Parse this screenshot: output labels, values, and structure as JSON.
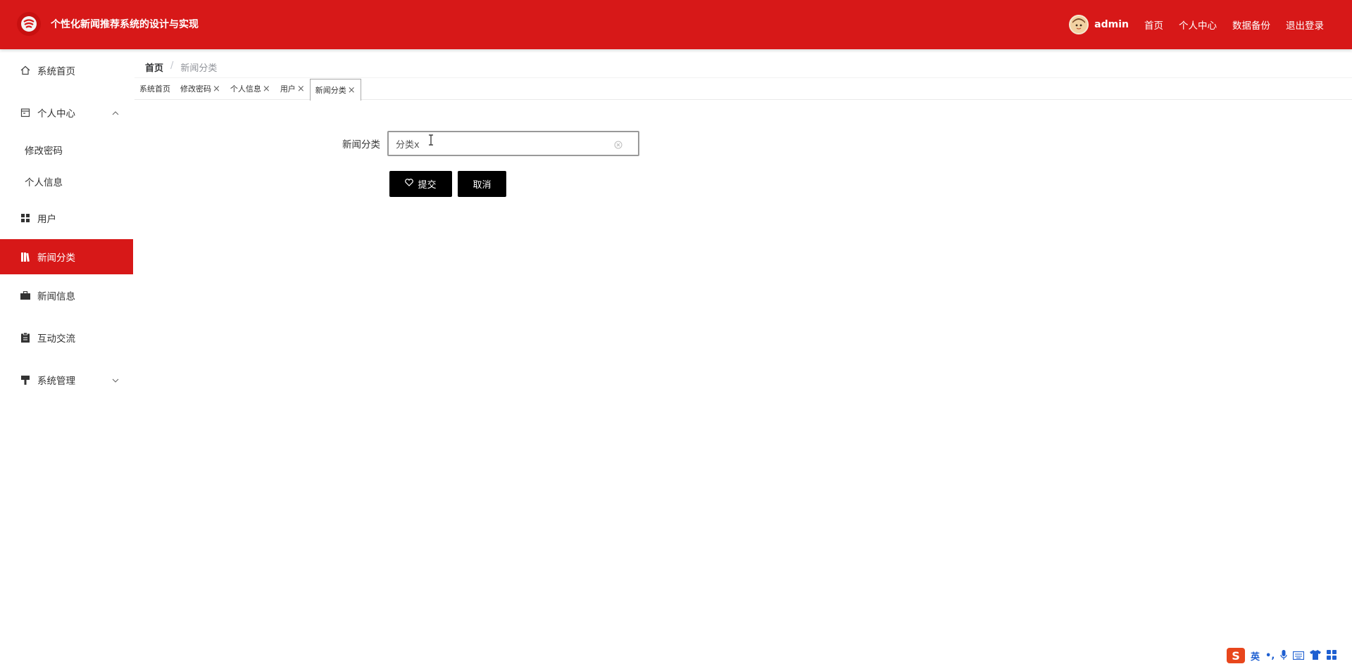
{
  "header": {
    "title": "个性化新闻推荐系统的设计与实现",
    "username": "admin",
    "links": [
      "首页",
      "个人中心",
      "数据备份",
      "退出登录"
    ],
    "color": "#d71818"
  },
  "sidebar": {
    "items": [
      {
        "label": "系统首页",
        "icon": "home-icon"
      },
      {
        "label": "个人中心",
        "icon": "calendar-icon",
        "expanded": true,
        "children": [
          "修改密码",
          "个人信息"
        ]
      },
      {
        "label": "用户",
        "icon": "grid-icon"
      },
      {
        "label": "新闻分类",
        "icon": "book-icon",
        "active": true
      },
      {
        "label": "新闻信息",
        "icon": "briefcase-icon"
      },
      {
        "label": "互动交流",
        "icon": "clipboard-icon"
      },
      {
        "label": "系统管理",
        "icon": "hammer-icon",
        "expanded": false
      }
    ]
  },
  "breadcrumb": {
    "home": "首页",
    "separator": "/",
    "current": "新闻分类"
  },
  "tabs": [
    {
      "label": "系统首页",
      "closable": false
    },
    {
      "label": "修改密码",
      "closable": true
    },
    {
      "label": "个人信息",
      "closable": true
    },
    {
      "label": "用户",
      "closable": true
    },
    {
      "label": "新闻分类",
      "closable": true,
      "active": true
    }
  ],
  "form": {
    "label": "新闻分类",
    "value": "分类x",
    "submit_label": "提交",
    "cancel_label": "取消"
  },
  "ime": {
    "mode": "英",
    "punct": "•,"
  }
}
